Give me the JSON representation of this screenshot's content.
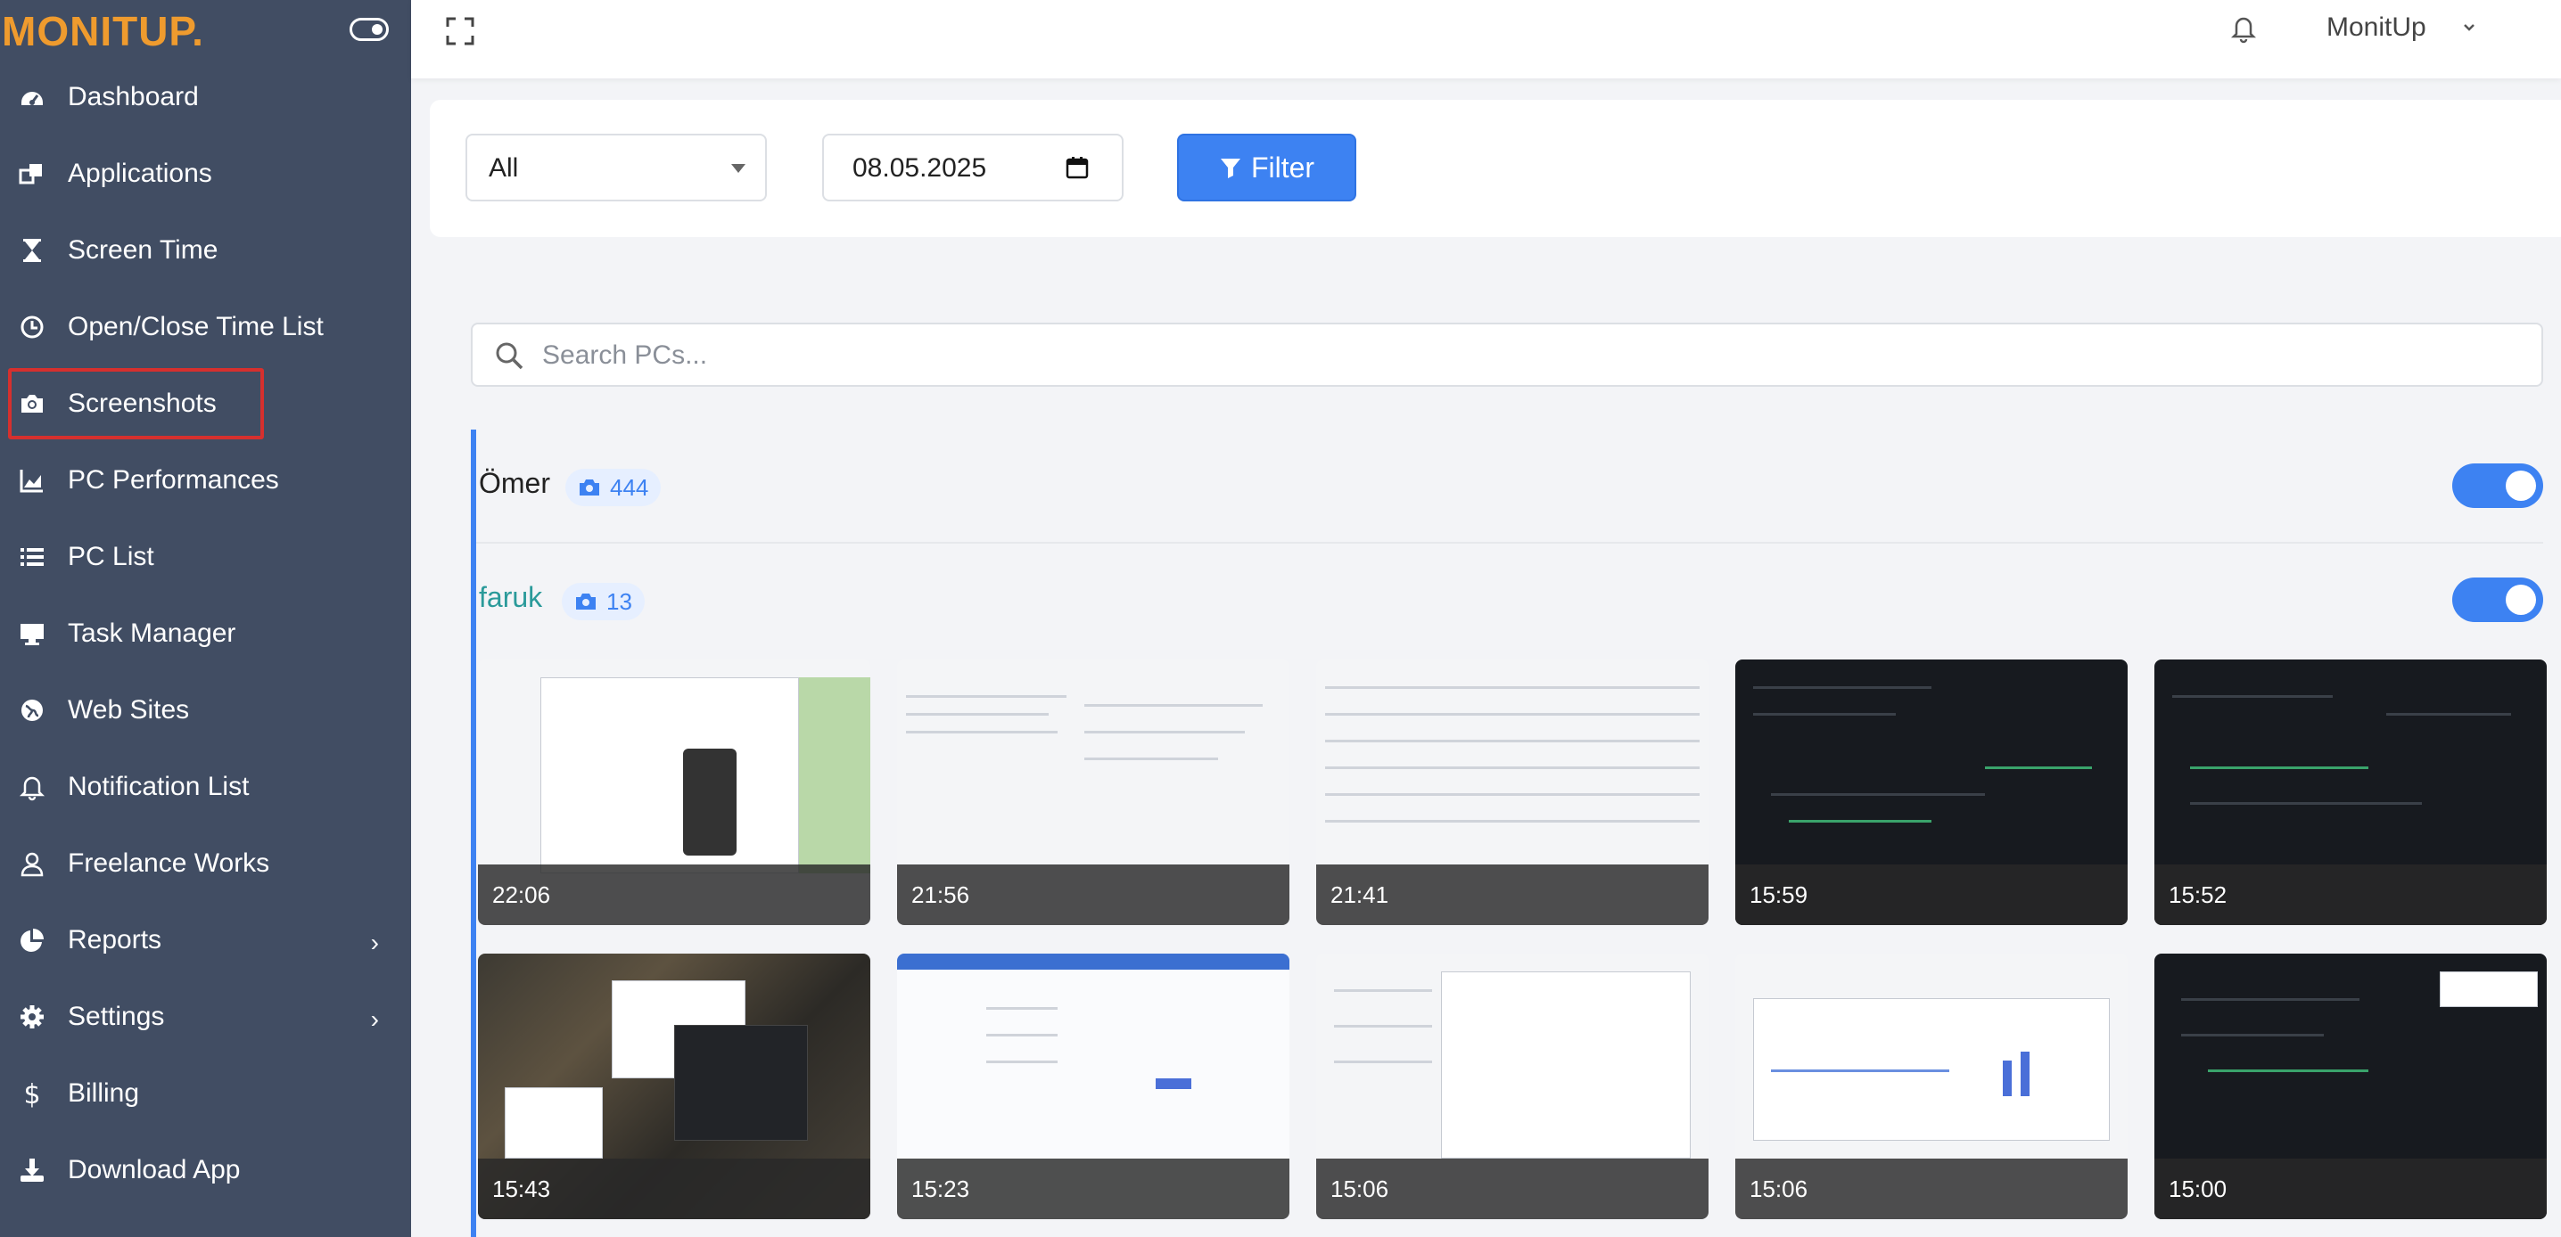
{
  "brand": {
    "name": "MONITUP."
  },
  "sidebar": {
    "items": [
      {
        "label": "Dashboard",
        "icon": "dashboard-icon"
      },
      {
        "label": "Applications",
        "icon": "applications-icon"
      },
      {
        "label": "Screen Time",
        "icon": "hourglass-icon"
      },
      {
        "label": "Open/Close Time List",
        "icon": "clock-icon"
      },
      {
        "label": "Screenshots",
        "icon": "camera-icon",
        "active": true
      },
      {
        "label": "PC Performances",
        "icon": "area-chart-icon"
      },
      {
        "label": "PC List",
        "icon": "list-icon"
      },
      {
        "label": "Task Manager",
        "icon": "monitor-icon"
      },
      {
        "label": "Web Sites",
        "icon": "globe-icon"
      },
      {
        "label": "Notification List",
        "icon": "bell-icon"
      },
      {
        "label": "Freelance Works",
        "icon": "user-icon"
      },
      {
        "label": "Reports",
        "icon": "pie-chart-icon",
        "submenu": true
      },
      {
        "label": "Settings",
        "icon": "gear-icon",
        "submenu": true
      },
      {
        "label": "Billing",
        "icon": "dollar-icon"
      },
      {
        "label": "Download App",
        "icon": "download-icon"
      }
    ]
  },
  "topbar": {
    "user_name": "MonitUp"
  },
  "filter": {
    "select_value": "All",
    "date_value": "08.05.2025",
    "button_label": "Filter"
  },
  "search": {
    "placeholder": "Search PCs..."
  },
  "pcs": [
    {
      "name": "Ömer",
      "count": "444",
      "enabled": true
    },
    {
      "name": "faruk",
      "count": "13",
      "enabled": true
    }
  ],
  "screenshots": [
    {
      "time": "22:06",
      "style": "light"
    },
    {
      "time": "21:56",
      "style": "light"
    },
    {
      "time": "21:41",
      "style": "light"
    },
    {
      "time": "15:59",
      "style": "dark"
    },
    {
      "time": "15:52",
      "style": "dark"
    },
    {
      "time": "15:43",
      "style": "photo"
    },
    {
      "time": "15:23",
      "style": "light"
    },
    {
      "time": "15:06",
      "style": "light"
    },
    {
      "time": "15:06",
      "style": "light"
    },
    {
      "time": "15:00",
      "style": "dark"
    }
  ],
  "colors": {
    "sidebar_bg": "#414d63",
    "brand": "#ef9b2e",
    "accent": "#3d82f2",
    "active_highlight": "#d6302e",
    "pc_link": "#2a9a9a"
  }
}
